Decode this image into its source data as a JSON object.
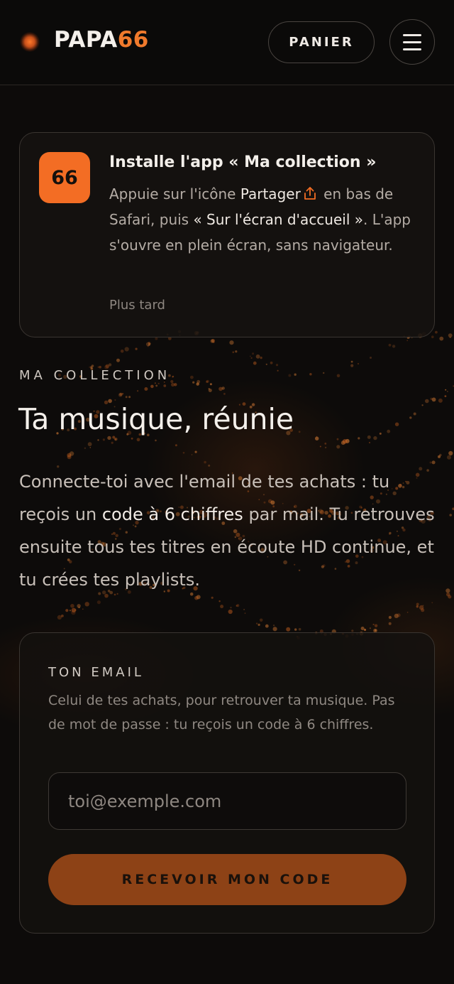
{
  "header": {
    "logo_main": "PAPA",
    "logo_accent": "66",
    "cart_label": "PANIER",
    "menu_icon": "hamburger-menu-icon"
  },
  "install": {
    "app_badge": "66",
    "title": "Installe l'app « Ma collection »",
    "text_before": "Appuie sur l'icône ",
    "share_label": "Partager",
    "share_icon": "share-icon",
    "text_middle": " en bas de Safari, puis ",
    "home_screen": "« Sur l'écran d'accueil »",
    "text_after": ". L'app s'ouvre en plein écran, sans navigateur.",
    "later_label": "Plus tard",
    "accent_color": "#f36d24"
  },
  "hero": {
    "eyebrow": "MA COLLECTION",
    "title": "Ta musique, réunie",
    "text_before": "Connecte-toi avec l'email de tes achats : tu reçois un ",
    "code_highlight": "code à 6 chiffres",
    "text_after": " par mail. Tu retrouves ensuite tous tes titres en écoute HD continue, et tu crées tes playlists."
  },
  "form": {
    "label": "TON EMAIL",
    "help": "Celui de tes achats, pour retrouver ta musique. Pas de mot de passe : tu reçois un code à 6 chiffres.",
    "email_placeholder": "toi@exemple.com",
    "email_value": "",
    "submit_label": "RECEVOIR MON CODE",
    "button_color": "#8d4216"
  }
}
